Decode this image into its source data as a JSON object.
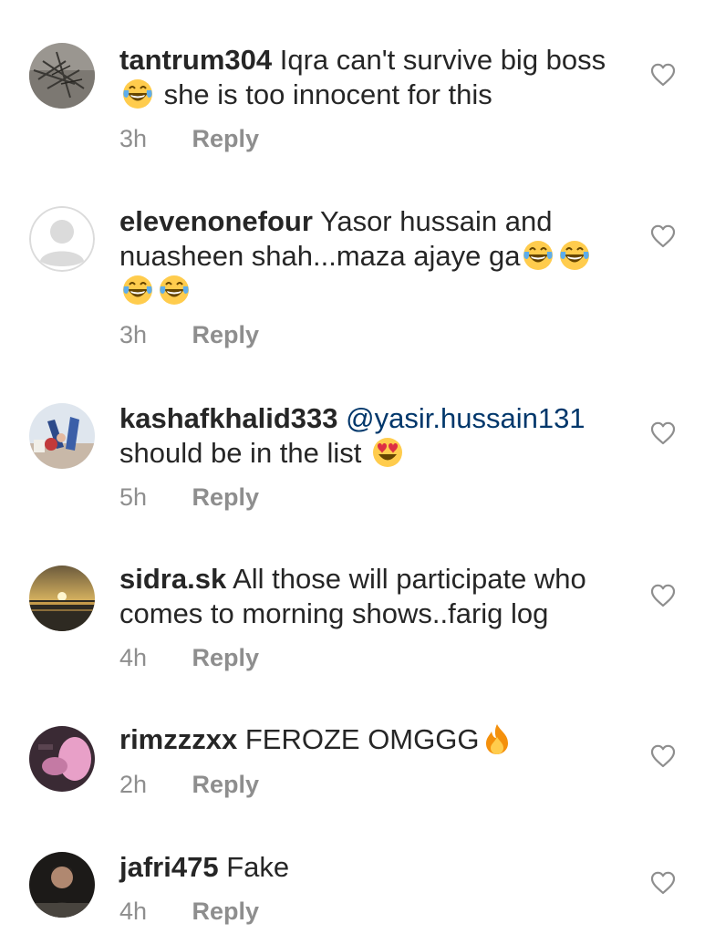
{
  "comments": [
    {
      "username": "tantrum304",
      "text_parts": [
        "Iqra can't survive big boss",
        "she is too innocent for this"
      ],
      "time": "3h",
      "reply_label": "Reply",
      "avatar": "avatar-photo-dark-branches",
      "emojis": [
        "face-with-tears-of-joy"
      ]
    },
    {
      "username": "elevenonefour",
      "text_parts": [
        "Yasor hussain and",
        "nuasheen shah...maza ajaye ga"
      ],
      "time": "3h",
      "reply_label": "Reply",
      "avatar": "default-avatar",
      "emojis": [
        "face-with-tears-of-joy",
        "face-with-tears-of-joy",
        "face-with-tears-of-joy",
        "face-with-tears-of-joy"
      ]
    },
    {
      "username": "kashafkhalid333",
      "mention": "@yasir.hussain131",
      "text_parts": [
        "should be in the list"
      ],
      "time": "5h",
      "reply_label": "Reply",
      "avatar": "avatar-photo-people",
      "emojis": [
        "smiling-face-with-heart-eyes"
      ]
    },
    {
      "username": "sidra.sk",
      "text_parts": [
        "All those will participate who",
        "comes to morning shows..farig log"
      ],
      "time": "4h",
      "reply_label": "Reply",
      "avatar": "avatar-photo-sunset"
    },
    {
      "username": "rimzzzxx",
      "text_parts": [
        "FEROZE OMGGG"
      ],
      "time": "2h",
      "reply_label": "Reply",
      "avatar": "avatar-photo-pink",
      "emojis": [
        "fire"
      ]
    },
    {
      "username": "jafri475",
      "text_parts": [
        "Fake"
      ],
      "time": "4h",
      "reply_label": "Reply",
      "avatar": "avatar-photo-person"
    }
  ],
  "colors": {
    "text": "#262626",
    "secondary": "#8e8e8e",
    "mention": "#00376b",
    "background": "#ffffff"
  },
  "icons": {
    "like": "heart-outline-icon"
  }
}
